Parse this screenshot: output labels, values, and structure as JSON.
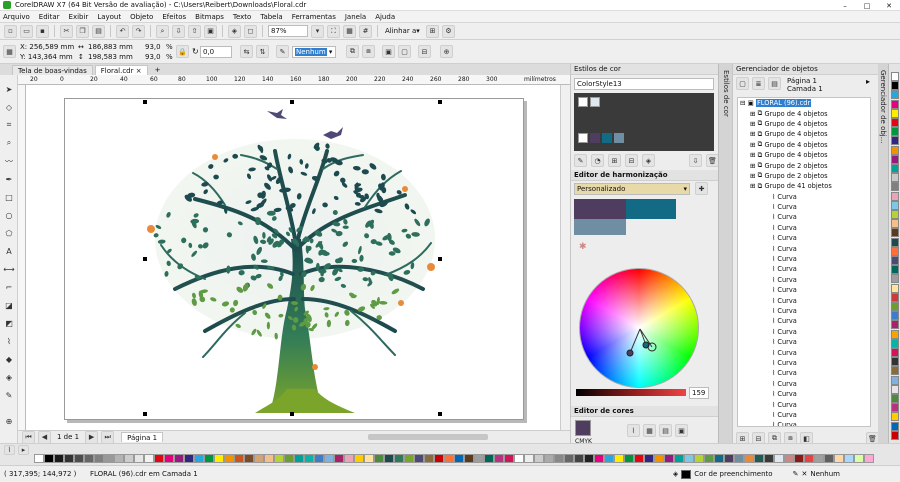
{
  "window": {
    "title": "CorelDRAW X7 (64 Bit Versão de avaliação) - C:\\Users\\Reibert\\Downloads\\Floral.cdr"
  },
  "menu": [
    "Arquivo",
    "Editar",
    "Exibir",
    "Layout",
    "Objeto",
    "Efeitos",
    "Bitmaps",
    "Texto",
    "Tabela",
    "Ferramentas",
    "Janela",
    "Ajuda"
  ],
  "toolbar": {
    "zoom": "87%",
    "align_label": "Alinhar a"
  },
  "props": {
    "x": "X: 256,589 mm",
    "y": "Y: 143,364 mm",
    "w": "186,883 mm",
    "h": "198,583 mm",
    "sx": "93,0",
    "sy": "93,0",
    "pct": "%",
    "angle": "0,0",
    "outline": "Nenhum"
  },
  "tabs": [
    "Tela de boas-vindas",
    "Floral.cdr"
  ],
  "ruler_h": [
    "20",
    "0",
    "20",
    "40",
    "60",
    "80",
    "100",
    "120",
    "140",
    "160",
    "180",
    "200",
    "220",
    "240",
    "260",
    "280",
    "300"
  ],
  "ruler_unit": "milímetros",
  "pagenav": {
    "pos": "1 de 1",
    "page": "Página 1"
  },
  "status": {
    "coords": "( 317,395; 144,972 )",
    "info": "FLORAL (96).cdr em Camada 1",
    "fill_label": "Cor de preenchimento",
    "outline_label": "Nenhum"
  },
  "styles_panel": {
    "title": "Estilos de cor",
    "style_name": "ColorStyle13",
    "harmony_title": "Editor de harmonização",
    "harmony_mode": "Personalizado",
    "value": "159",
    "color_editor_title": "Editor de cores",
    "color_model": "CMYK",
    "dock_tab": "Estilos de cor",
    "harmony_colors": [
      "#4e3d5e",
      "#126a84",
      "#6f8ea4"
    ]
  },
  "objects_panel": {
    "title": "Gerenciador de objetos",
    "page": "Página 1",
    "layer": "Camada 1",
    "dock_tab": "Gerenciador de obj...",
    "selected": "FLORAL (96).cdr",
    "groups": [
      "Grupo de 4 objetos",
      "Grupo de 4 objetos",
      "Grupo de 4 objetos",
      "Grupo de 4 objetos",
      "Grupo de 4 objetos",
      "Grupo de 2 objetos",
      "Grupo de 2 objetos",
      "Grupo de 41 objetos"
    ],
    "curves": [
      "Curva",
      "Curva",
      "Curva",
      "Curva",
      "Curva",
      "Curva",
      "Curva",
      "Curva",
      "Curva",
      "Curva",
      "Curva",
      "Curva",
      "Curva",
      "Curva",
      "Curva",
      "Curva",
      "Curva",
      "Curva",
      "Curva",
      "Curva",
      "Curva",
      "Curva",
      "Curva"
    ]
  },
  "colors": {
    "accent": "#2f7fd0",
    "canvas_tree_dark": "#1d4a4e",
    "canvas_tree_mid": "#2e7a5a",
    "canvas_tree_light": "#7aa42a",
    "bird": "#4d4a78",
    "butterfly": "#e88a3a"
  }
}
